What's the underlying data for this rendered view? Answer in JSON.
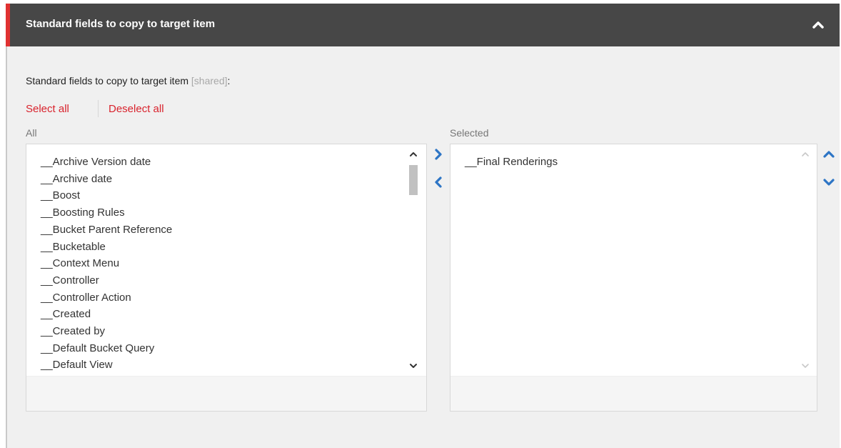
{
  "header": {
    "title": "Standard fields to copy to target item"
  },
  "field": {
    "label": "Standard fields to copy to target item",
    "shared_tag": "[shared]",
    "colon": ":"
  },
  "actions": {
    "select_all": "Select all",
    "deselect_all": "Deselect all"
  },
  "all_list": {
    "label": "All",
    "items": [
      "__Archive Version date",
      "__Archive date",
      "__Boost",
      "__Boosting Rules",
      "__Bucket Parent Reference",
      "__Bucketable",
      "__Context Menu",
      "__Controller",
      "__Controller Action",
      "__Created",
      "__Created by",
      "__Default Bucket Query",
      "__Default View"
    ]
  },
  "selected_list": {
    "label": "Selected",
    "items": [
      "__Final Renderings"
    ]
  },
  "colors": {
    "header_bg": "#474747",
    "accent": "#e03131",
    "link": "#d9232d",
    "arrow_blue": "#2d75c5"
  },
  "icons": {
    "collapse": "chevron-up-icon",
    "add": "chevron-right-icon",
    "remove": "chevron-left-icon",
    "move_up": "chevron-up-icon",
    "move_down": "chevron-down-icon"
  }
}
